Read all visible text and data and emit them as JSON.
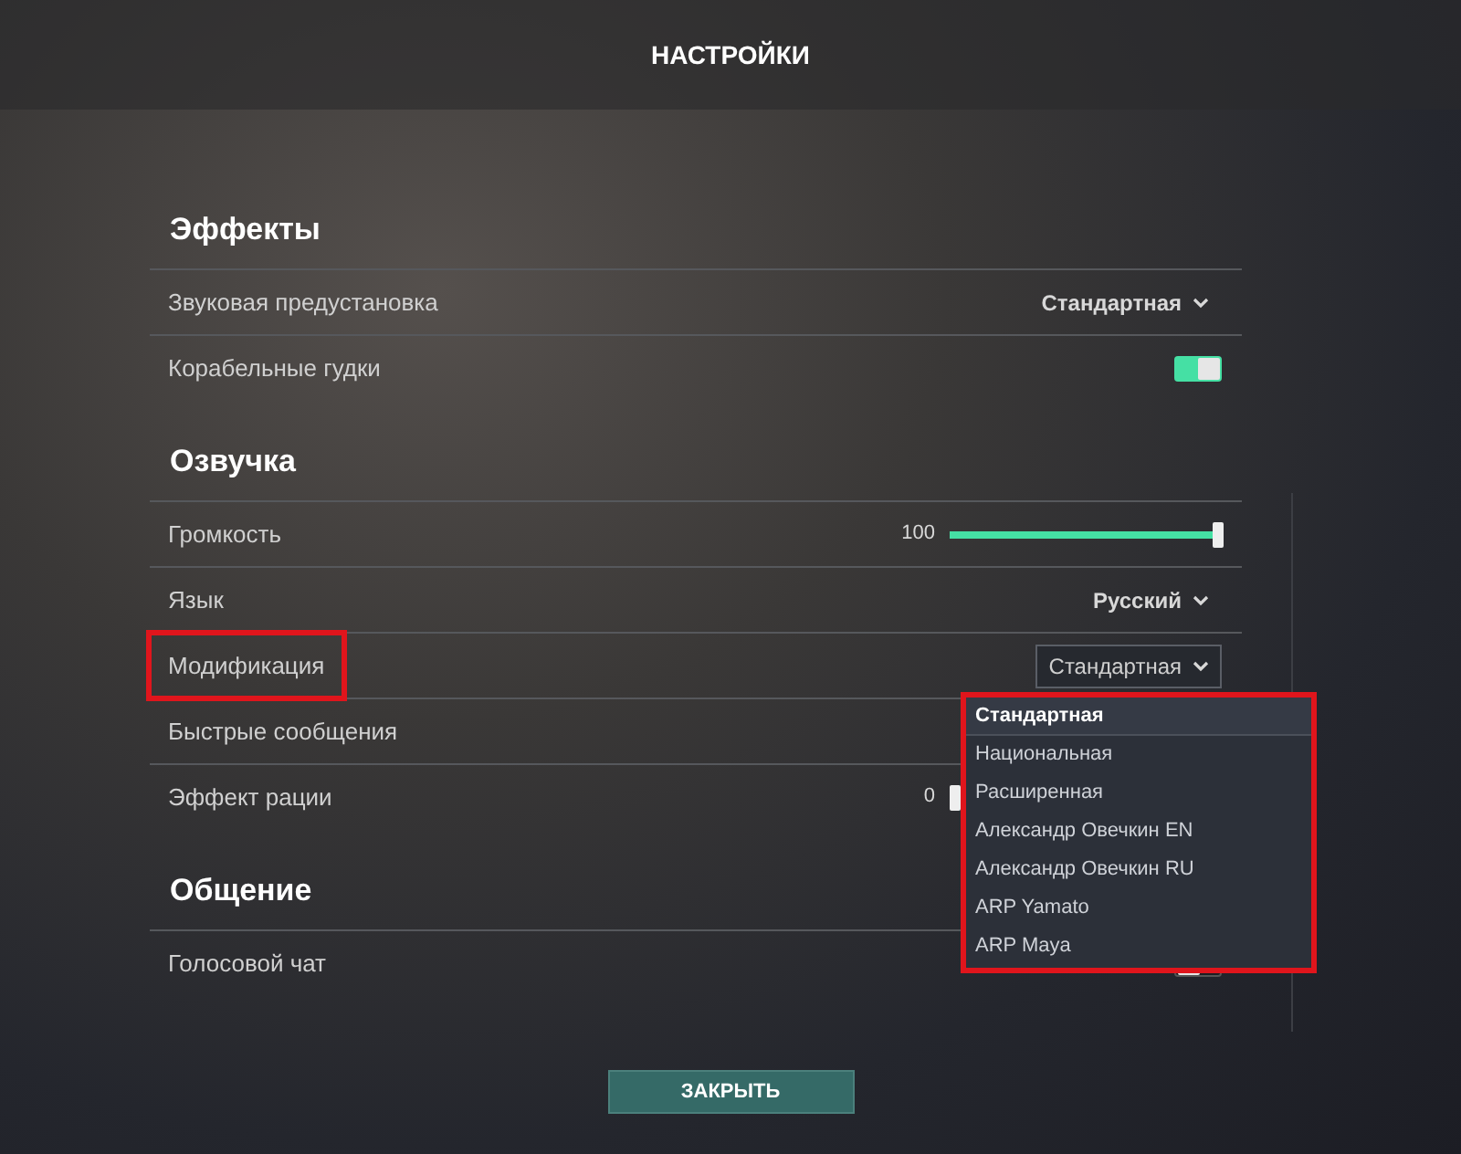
{
  "window": {
    "title": "НАСТРОЙКИ"
  },
  "sections": [
    {
      "title": "Эффекты",
      "rows": [
        {
          "label": "Звуковая предустановка",
          "kind": "select",
          "value": "Стандартная",
          "highlighted": false
        },
        {
          "label": "Корабельные гудки",
          "kind": "toggle",
          "on": true,
          "highlighted": false
        }
      ]
    },
    {
      "title": "Озвучка",
      "rows": [
        {
          "label": "Громкость",
          "kind": "slider",
          "reading": "100",
          "level": 1,
          "highlighted": false
        },
        {
          "label": "Язык",
          "kind": "select",
          "value": "Русский",
          "highlighted": false
        },
        {
          "label": "Модификация",
          "kind": "open_select",
          "value": "Стандартная",
          "highlighted": true
        },
        {
          "label": "Быстрые сообщения",
          "kind": "hidden",
          "highlighted": false
        },
        {
          "label": "Эффект рации",
          "kind": "slider",
          "reading": "0",
          "level": 0,
          "highlighted": false
        }
      ]
    },
    {
      "title": "Общение",
      "rows": [
        {
          "label": "Голосовой чат",
          "kind": "toggle",
          "on": false,
          "highlighted": false
        }
      ]
    }
  ],
  "dropdown": {
    "highlighted": true,
    "options": [
      {
        "label": "Стандартная",
        "selected": true
      },
      {
        "label": "Национальная",
        "selected": false
      },
      {
        "label": "Расширенная",
        "selected": false
      },
      {
        "label": "Александр Овечкин EN",
        "selected": false
      },
      {
        "label": "Александр Овечкин RU",
        "selected": false
      },
      {
        "label": "ARP Yamato",
        "selected": false
      },
      {
        "label": "ARP Maya",
        "selected": false
      }
    ]
  },
  "close_button": "ЗАКРЫТЬ"
}
